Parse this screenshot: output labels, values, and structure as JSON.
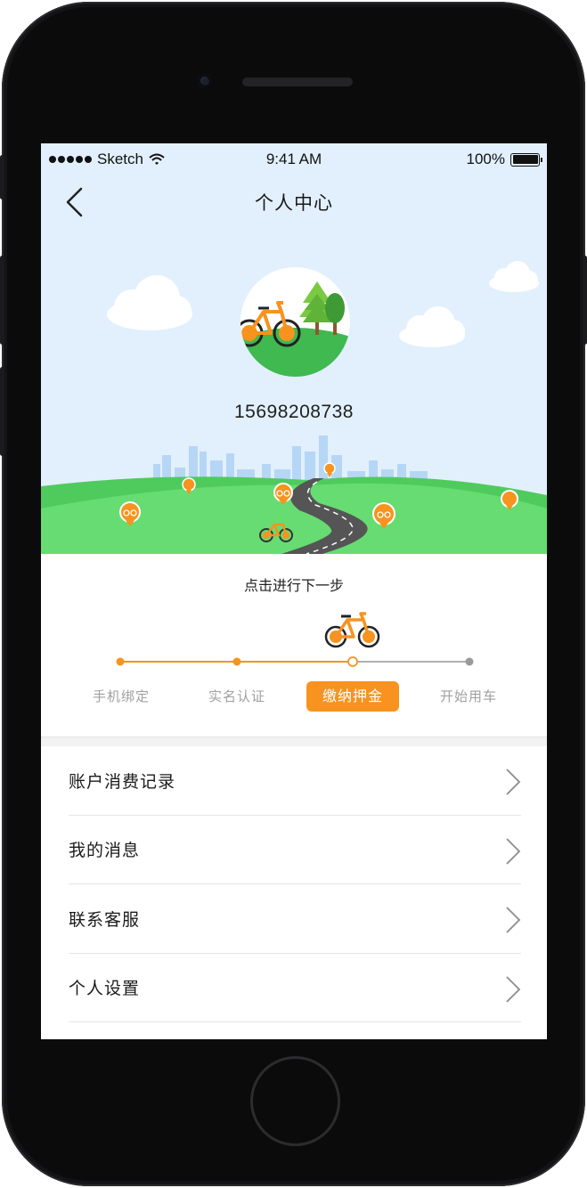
{
  "status_bar": {
    "carrier": "Sketch",
    "time": "9:41 AM",
    "battery": "100%"
  },
  "nav": {
    "title": "个人中心"
  },
  "profile": {
    "phone": "15698208738"
  },
  "progress": {
    "hint": "点击进行下一步",
    "steps": [
      {
        "label": "手机绑定",
        "done": true
      },
      {
        "label": "实名认证",
        "done": true
      },
      {
        "label": "缴纳押金",
        "active": true
      },
      {
        "label": "开始用车",
        "done": false
      }
    ]
  },
  "menu": {
    "items": [
      {
        "label": "账户消费记录"
      },
      {
        "label": "我的消息"
      },
      {
        "label": "联系客服"
      },
      {
        "label": "个人设置"
      }
    ]
  },
  "colors": {
    "accent": "#f7931e",
    "sky": "#e2f0fd",
    "grass": "#63d86f",
    "inactive": "#a0a0a0"
  },
  "icons": {
    "back": "chevron-left-icon",
    "menu_arrow": "chevron-right-icon"
  }
}
